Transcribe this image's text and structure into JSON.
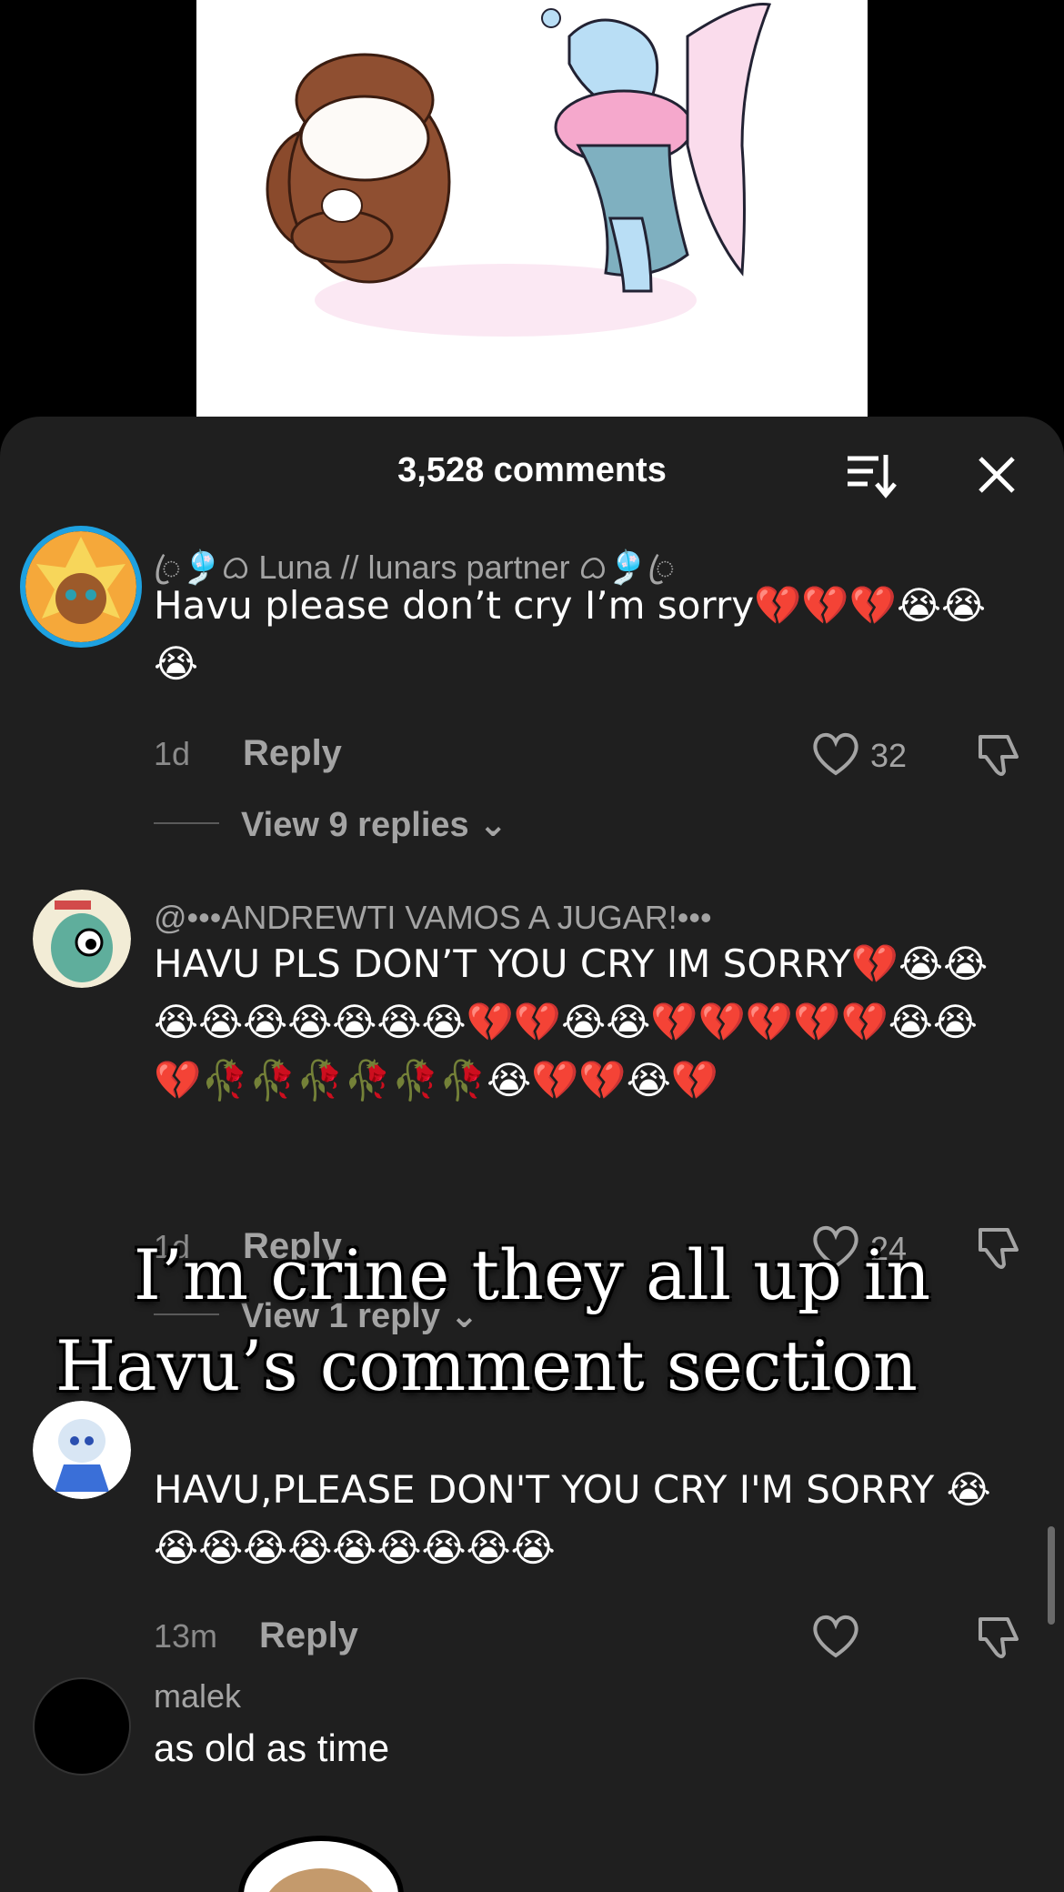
{
  "sheet": {
    "comments_count": "3,528 comments",
    "sort_icon": "sort-icon",
    "close_icon": "close-icon"
  },
  "comments": [
    {
      "username": "ꦿ🎐ᜊ Luna // lunars partner ᜊ🎐ꦿ",
      "text": "Havu please don’t cry I’m sorry💔💔💔😭😭😭",
      "time": "1d",
      "reply_label": "Reply",
      "likes": "32",
      "view_replies": "View 9 replies"
    },
    {
      "username": "@•••ANDREWTI VAMOS A JUGAR!•••",
      "text": "HAVU PLS DON’T YOU CRY IM SORRY💔😭😭😭😭😭😭😭😭😭💔💔😭😭💔💔💔💔💔😭😭💔🥀🥀🥀🥀🥀🥀😭💔💔😭💔",
      "time": "1d",
      "reply_label": "Reply",
      "likes": "24",
      "view_replies": "View 1 reply"
    },
    {
      "username": "",
      "text": "HAVU,PLEASE DON'T YOU CRY I'M SORRY 😭😭😭😭😭😭😭😭😭😭",
      "time": "13m",
      "reply_label": "Reply",
      "likes": ""
    },
    {
      "username": "malek",
      "text": "as old as time"
    }
  ],
  "overlay": {
    "line1": "I’m crine they all up in",
    "line2": "Havu’s comment section"
  },
  "colors": {
    "sheet_bg": "#1f1f1f",
    "text_primary": "#ffffff",
    "text_secondary": "#a4a4a4",
    "avatar_ring": "#1ea1e0"
  }
}
